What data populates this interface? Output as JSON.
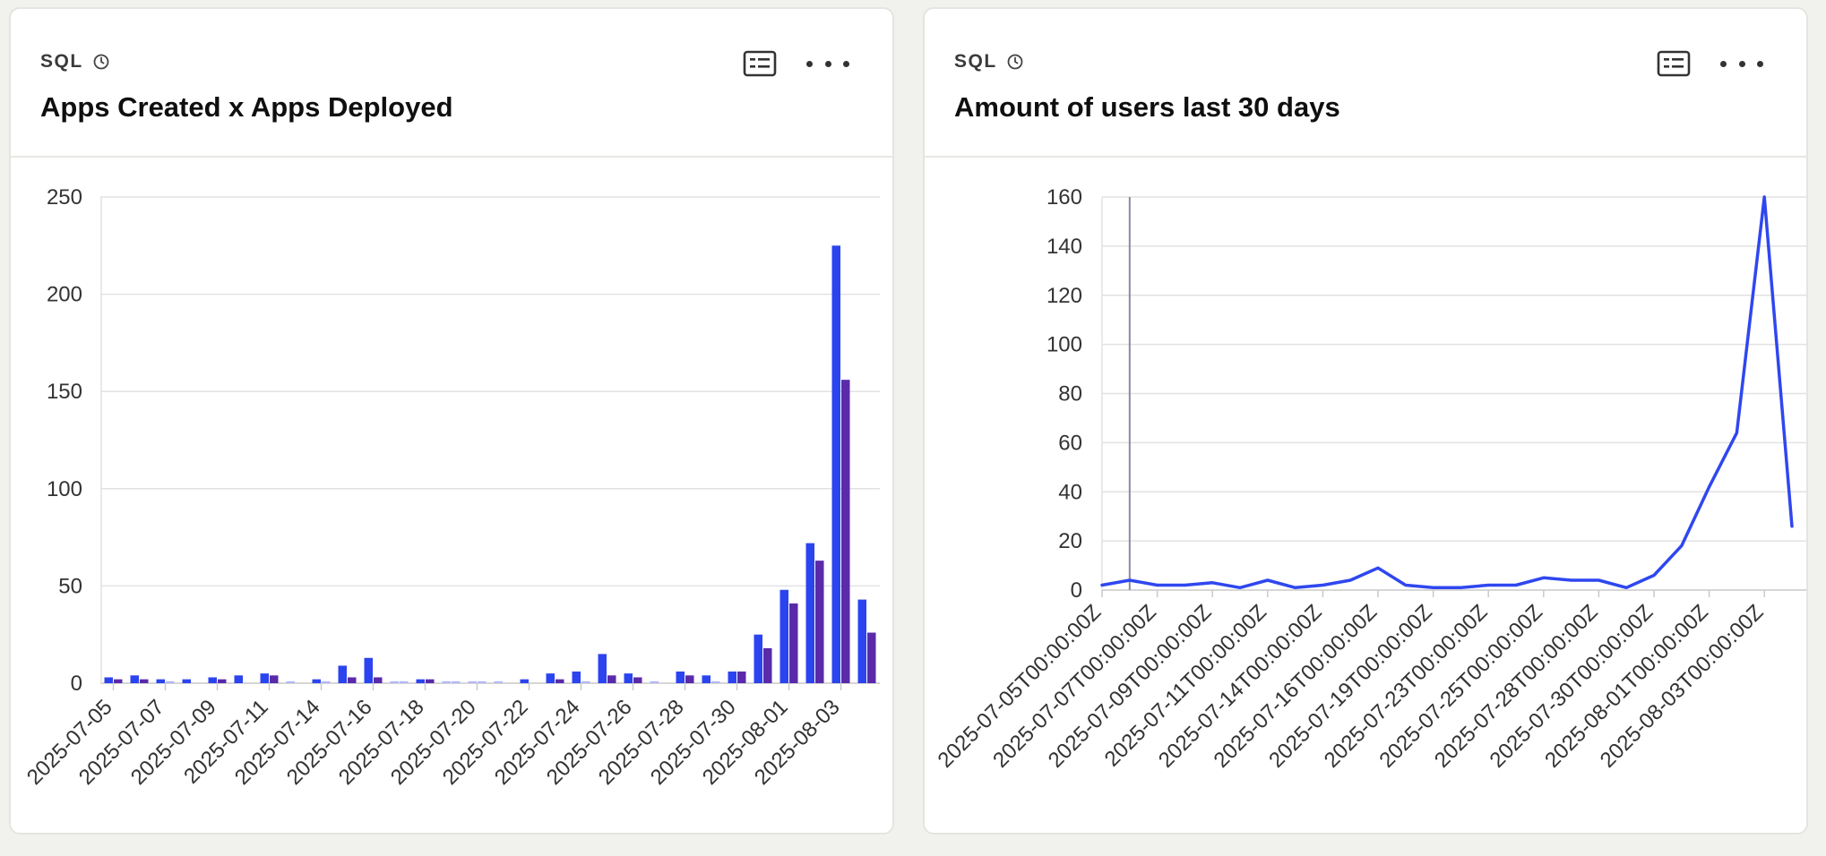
{
  "colors": {
    "series_created": "#2b44f0",
    "series_deployed": "#5a2aa8",
    "series_ghost": "#b4b8f8",
    "line": "#2f47ef",
    "grid": "#e2e2e2",
    "axis": "#c9c9c9"
  },
  "cards": [
    {
      "source_label": "SQL",
      "title": "Apps Created x Apps Deployed",
      "icons": {
        "history": "clock-icon",
        "legend": "legend-icon",
        "more": "more-dots-icon"
      }
    },
    {
      "source_label": "SQL",
      "title": "Amount of users last 30 days",
      "icons": {
        "history": "clock-icon",
        "legend": "legend-icon",
        "more": "more-dots-icon"
      }
    }
  ],
  "chart_data": [
    {
      "type": "bar",
      "title": "Apps Created x Apps Deployed",
      "xlabel": "",
      "ylabel": "",
      "ylim": [
        0,
        250
      ],
      "yticks": [
        0,
        50,
        100,
        150,
        200,
        250
      ],
      "grid": true,
      "categories": [
        "2025-07-05",
        "2025-07-06",
        "2025-07-07",
        "2025-07-08",
        "2025-07-09",
        "2025-07-10",
        "2025-07-11",
        "2025-07-12",
        "2025-07-14",
        "2025-07-15",
        "2025-07-16",
        "2025-07-17",
        "2025-07-18",
        "2025-07-19",
        "2025-07-20",
        "2025-07-21",
        "2025-07-22",
        "2025-07-23",
        "2025-07-24",
        "2025-07-25",
        "2025-07-26",
        "2025-07-27",
        "2025-07-28",
        "2025-07-29",
        "2025-07-30",
        "2025-07-31",
        "2025-08-01",
        "2025-08-02",
        "2025-08-03",
        "2025-08-04"
      ],
      "tick_labels": [
        "2025-07-05",
        "2025-07-07",
        "2025-07-09",
        "2025-07-11",
        "2025-07-14",
        "2025-07-16",
        "2025-07-18",
        "2025-07-20",
        "2025-07-22",
        "2025-07-24",
        "2025-07-26",
        "2025-07-28",
        "2025-07-30",
        "2025-08-01",
        "2025-08-03"
      ],
      "series": [
        {
          "values": [
            3,
            4,
            2,
            2,
            3,
            4,
            5,
            1,
            2,
            9,
            13,
            1,
            2,
            1,
            1,
            1,
            2,
            5,
            6,
            15,
            5,
            1,
            6,
            4,
            6,
            25,
            48,
            72,
            225,
            43
          ]
        },
        {
          "values": [
            2,
            2,
            1,
            0,
            2,
            0,
            4,
            0,
            1,
            3,
            3,
            1,
            2,
            1,
            1,
            0,
            0,
            2,
            1,
            4,
            3,
            0,
            4,
            1,
            6,
            18,
            41,
            63,
            156,
            26
          ]
        }
      ]
    },
    {
      "type": "line",
      "title": "Amount of users last 30 days",
      "xlabel": "",
      "ylabel": "",
      "ylim": [
        0,
        160
      ],
      "yticks": [
        0,
        20,
        40,
        60,
        80,
        100,
        120,
        140,
        160
      ],
      "grid": true,
      "x": [
        "2025-07-05T00:00:00Z",
        "2025-07-06T00:00:00Z",
        "2025-07-07T00:00:00Z",
        "2025-07-08T00:00:00Z",
        "2025-07-09T00:00:00Z",
        "2025-07-10T00:00:00Z",
        "2025-07-11T00:00:00Z",
        "2025-07-12T00:00:00Z",
        "2025-07-14T00:00:00Z",
        "2025-07-15T00:00:00Z",
        "2025-07-16T00:00:00Z",
        "2025-07-17T00:00:00Z",
        "2025-07-19T00:00:00Z",
        "2025-07-22T00:00:00Z",
        "2025-07-23T00:00:00Z",
        "2025-07-24T00:00:00Z",
        "2025-07-25T00:00:00Z",
        "2025-07-26T00:00:00Z",
        "2025-07-27T00:00:00Z",
        "2025-07-28T00:00:00Z",
        "2025-07-29T00:00:00Z",
        "2025-07-30T00:00:00Z",
        "2025-07-31T00:00:00Z",
        "2025-08-01T00:00:00Z",
        "2025-08-02T00:00:00Z",
        "2025-08-03T00:00:00Z",
        "2025-08-04T00:00:00Z"
      ],
      "tick_labels": [
        "2025-07-05T00:00:00Z",
        "2025-07-07T00:00:00Z",
        "2025-07-09T00:00:00Z",
        "2025-07-11T00:00:00Z",
        "2025-07-14T00:00:00Z",
        "2025-07-16T00:00:00Z",
        "2025-07-19T00:00:00Z",
        "2025-07-23T00:00:00Z",
        "2025-07-25T00:00:00Z",
        "2025-07-28T00:00:00Z",
        "2025-07-30T00:00:00Z",
        "2025-08-01T00:00:00Z",
        "2025-08-03T00:00:00Z"
      ],
      "series": [
        {
          "values": [
            2,
            4,
            2,
            2,
            3,
            1,
            4,
            1,
            2,
            4,
            9,
            2,
            1,
            1,
            2,
            2,
            5,
            4,
            4,
            1,
            6,
            18,
            42,
            64,
            160,
            26
          ]
        }
      ],
      "hover_marker_index": 1
    }
  ]
}
